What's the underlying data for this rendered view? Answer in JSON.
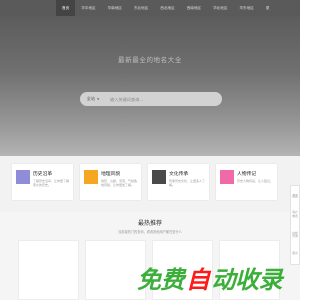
{
  "nav": {
    "items": [
      {
        "label": "首页",
        "active": true
      },
      {
        "label": "华中地区",
        "active": false
      },
      {
        "label": "华南地区",
        "active": false
      },
      {
        "label": "东北地区",
        "active": false
      },
      {
        "label": "西北地区",
        "active": false
      },
      {
        "label": "西南地区",
        "active": false
      },
      {
        "label": "华北地区",
        "active": false
      },
      {
        "label": "华东地区",
        "active": false
      },
      {
        "label": "更",
        "active": false
      }
    ]
  },
  "hero": {
    "title": "最新最全的地名大全",
    "search": {
      "category": "全站",
      "placeholder": "输入关键词查询..."
    }
  },
  "cards": [
    {
      "title": "历史沿革",
      "desc": "了解历史沿革，让你更了解家乡的历史。",
      "color": "#8f8cd8"
    },
    {
      "title": "地理风貌",
      "desc": "地形、山脉、河流，气候各地风貌，让你更加了解。",
      "color": "#f5a623"
    },
    {
      "title": "文化传承",
      "desc": "传承历史文化，让更多人了解。",
      "color": "#4a4a4a"
    },
    {
      "title": "人物传记",
      "desc": "历史人物风采，让人铭记。",
      "color": "#f06aa8"
    }
  ],
  "recommend": {
    "title": "最热推荐",
    "subtitle": "当前最热门的查询，看看其他用户都在查什么"
  },
  "side_panel": {
    "items": [
      "首页",
      "客户电话",
      "在线咨询",
      "留言"
    ]
  },
  "watermark": {
    "green": "免费",
    "red": "自",
    "green2": "动收录"
  }
}
